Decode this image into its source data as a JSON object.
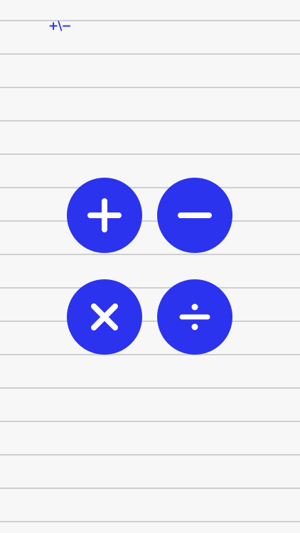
{
  "header": {
    "logo_text": "+\\−"
  },
  "operations": [
    {
      "label": "+",
      "icon": "plus-icon"
    },
    {
      "label": "−",
      "icon": "minus-icon"
    },
    {
      "label": "×",
      "icon": "multiply-icon"
    },
    {
      "label": "÷",
      "icon": "divide-icon"
    }
  ],
  "colors": {
    "accent": "#2b33ee",
    "background": "#f7f7f7",
    "rule_line": "#cfcfcf",
    "icon": "#ffffff"
  }
}
